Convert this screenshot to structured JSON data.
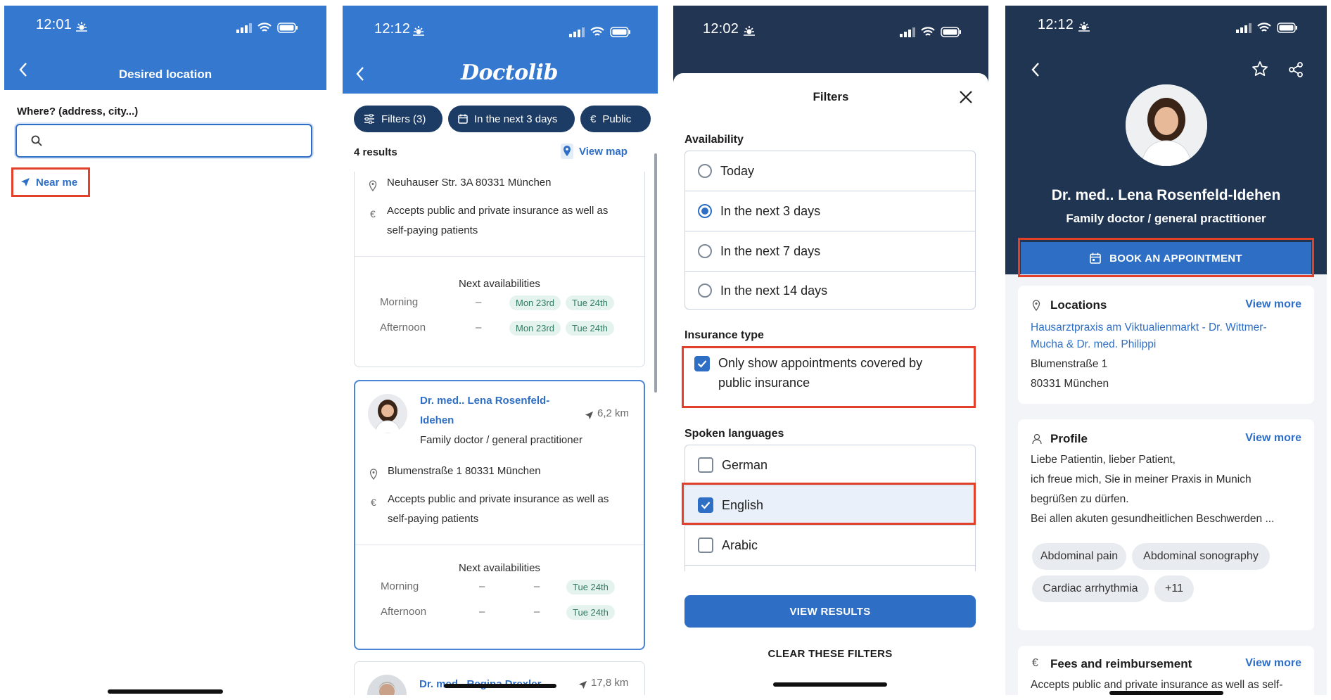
{
  "colors": {
    "brand_blue": "#3578cf",
    "primary_blue": "#2e6fc5",
    "dark_navy": "#203552",
    "highlight_red": "#e3402b",
    "slot_green": "#2f7a62"
  },
  "screen1": {
    "time": "12:01",
    "title": "Desired location",
    "where_label": "Where? (address, city...)",
    "search_value": "",
    "near_me": "Near me"
  },
  "screen2": {
    "time": "12:12",
    "brand": "Doctolib",
    "chips": {
      "filters": "Filters (3)",
      "date": "In the next 3 days",
      "insurance": "Public"
    },
    "results_count": "4 results",
    "view_map": "View map",
    "card1": {
      "address": "Neuhauser Str. 3A 80331 München",
      "insurance_line1": "Accepts public and private insurance as well as",
      "insurance_line2": "self-paying patients",
      "next_avail": "Next availabilities",
      "morning": "Morning",
      "afternoon": "Afternoon",
      "dash": "–",
      "morning_slots": [
        "Mon 23rd",
        "Tue 24th"
      ],
      "afternoon_slots": [
        "Mon 23rd",
        "Tue 24th"
      ]
    },
    "card2": {
      "name_line1": "Dr. med.. Lena Rosenfeld-",
      "name_line2": "Idehen",
      "distance": "6,2 km",
      "specialty": "Family doctor / general practitioner",
      "address": "Blumenstraße 1 80331 München",
      "insurance_line1": "Accepts public and private insurance as well as",
      "insurance_line2": "self-paying patients",
      "next_avail": "Next availabilities",
      "morning": "Morning",
      "afternoon": "Afternoon",
      "dash": "–",
      "morning_slot": "Tue 24th",
      "afternoon_slot": "Tue 24th"
    },
    "card3": {
      "name": "Dr. med.. Regina Drexler",
      "distance": "17,8 km"
    }
  },
  "screen3": {
    "time": "12:02",
    "title": "Filters",
    "availability_title": "Availability",
    "availability": [
      {
        "label": "Today",
        "selected": false
      },
      {
        "label": "In the next 3 days",
        "selected": true
      },
      {
        "label": "In the next 7 days",
        "selected": false
      },
      {
        "label": "In the next 14 days",
        "selected": false
      }
    ],
    "insurance_title": "Insurance type",
    "insurance_line1": "Only show appointments covered by",
    "insurance_line2": "public insurance",
    "insurance_checked": true,
    "languages_title": "Spoken languages",
    "languages": [
      {
        "label": "German",
        "checked": false
      },
      {
        "label": "English",
        "checked": true
      },
      {
        "label": "Arabic",
        "checked": false
      }
    ],
    "view_results": "VIEW RESULTS",
    "clear_filters": "CLEAR THESE FILTERS"
  },
  "screen4": {
    "time": "12:12",
    "doctor_name": "Dr. med.. Lena Rosenfeld-Idehen",
    "specialty": "Family doctor / general practitioner",
    "book": "BOOK AN APPOINTMENT",
    "locations": {
      "title": "Locations",
      "view_more": "View more",
      "link_line1": "Hausarztpraxis am Viktualienmarkt - Dr. Wittmer-",
      "link_line2": "Mucha & Dr. med. Philippi",
      "street": "Blumenstraße 1",
      "city": "80331 München"
    },
    "profile": {
      "title": "Profile",
      "view_more": "View more",
      "lines": [
        "Liebe Patientin, lieber Patient,",
        "ich freue mich, Sie in meiner Praxis in Munich",
        "begrüßen zu dürfen.",
        "Bei allen akuten gesundheitlichen Beschwerden ..."
      ],
      "tags": [
        "Abdominal pain",
        "Abdominal sonography",
        "Cardiac arrhythmia",
        "+11"
      ]
    },
    "fees": {
      "title": "Fees and reimbursement",
      "view_more": "View more",
      "text": "Accepts public and private insurance as well as self-"
    }
  }
}
